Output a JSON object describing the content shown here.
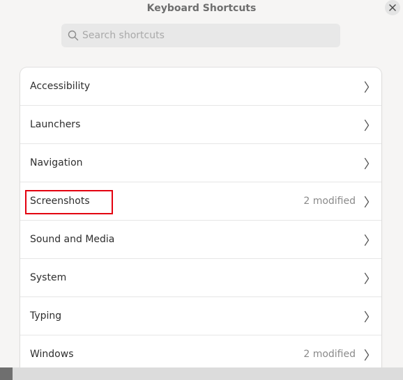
{
  "window": {
    "title": "Keyboard Shortcuts"
  },
  "search": {
    "placeholder": "Search shortcuts",
    "value": "",
    "icon": "search-icon"
  },
  "categories": [
    {
      "label": "Accessibility",
      "status": ""
    },
    {
      "label": "Launchers",
      "status": ""
    },
    {
      "label": "Navigation",
      "status": ""
    },
    {
      "label": "Screenshots",
      "status": "2 modified",
      "highlighted": true
    },
    {
      "label": "Sound and Media",
      "status": ""
    },
    {
      "label": "System",
      "status": ""
    },
    {
      "label": "Typing",
      "status": ""
    },
    {
      "label": "Windows",
      "status": "2 modified"
    }
  ],
  "colors": {
    "highlight": "#e3000f",
    "background": "#f6f5f4",
    "card": "#ffffff"
  }
}
